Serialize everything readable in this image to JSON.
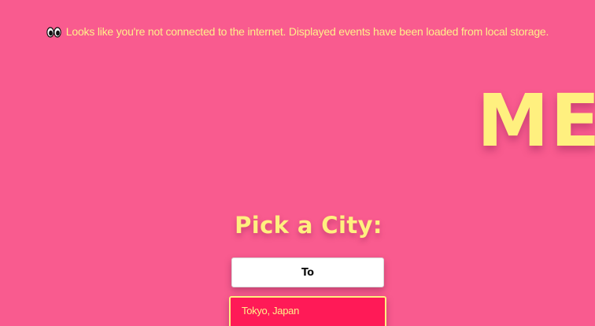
{
  "banner": {
    "icon": "eyes-icon",
    "message": "Looks like you're not connected to the internet. Displayed events have been loaded from local storage."
  },
  "hero": {
    "title": "MEE"
  },
  "city_picker": {
    "heading": "Pick a City:",
    "input_value": "To",
    "suggestions": [
      {
        "label": "Tokyo, Japan"
      }
    ]
  },
  "colors": {
    "background": "#f95b8f",
    "accent_yellow": "#fff07f",
    "suggestion_bg": "#ff1a57"
  }
}
